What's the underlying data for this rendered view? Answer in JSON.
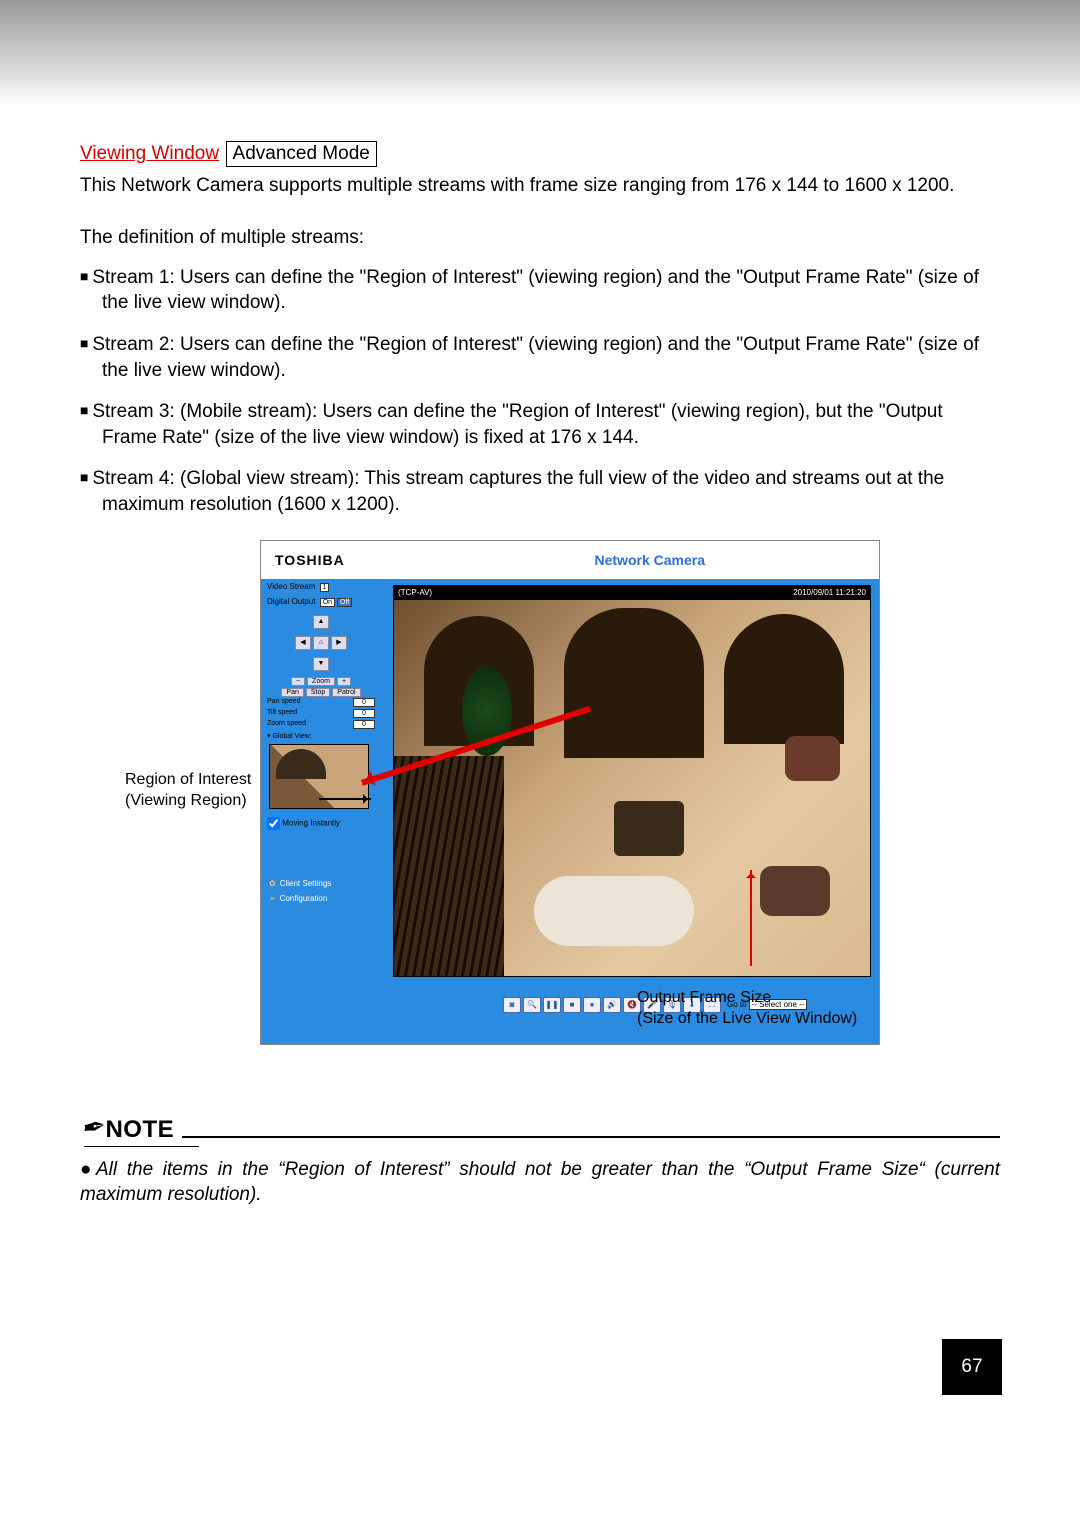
{
  "title": {
    "link": "Viewing Window",
    "badge": "Advanced Mode"
  },
  "intro": "This Network Camera supports multiple streams with frame size ranging from 176 x 144 to 1600 x 1200.",
  "defn_heading": "The definition of multiple streams:",
  "streams": [
    "Stream 1: Users can define the \"Region of Interest\" (viewing region) and the \"Output Frame Rate\" (size of the live view window).",
    "Stream 2: Users can define the \"Region of Interest\" (viewing region) and the \"Output Frame Rate\" (size of the live view window).",
    "Stream 3: (Mobile stream): Users can define the \"Region of Interest\" (viewing region), but the \"Output Frame Rate\" (size of the live view window) is fixed at 176 x 144.",
    "Stream 4: (Global view stream): This stream captures the full view of the video and streams out at the maximum resolution (1600 x 1200)."
  ],
  "camera_ui": {
    "brand": "TOSHIBA",
    "product": "Network Camera",
    "video_stream_label": "Video Stream",
    "video_stream_value": "1",
    "digital_output_label": "Digital Output",
    "digital_output_on": "On",
    "digital_output_off": "Off",
    "zoom_minus": "−",
    "zoom_label": "Zoom",
    "zoom_plus": "+",
    "pan_btn": "Pan",
    "stop_btn": "Stop",
    "patrol_btn": "Patrol",
    "pan_speed": "Pan speed",
    "tilt_speed": "Tilt speed",
    "zoom_speed": "Zoom speed",
    "speed_val": "0",
    "global_view": "Global View:",
    "moving_instantly": "Moving Instantly",
    "client_settings": "Client Settings",
    "configuration": "Configuration",
    "overlay_proto": "(TCP-AV)",
    "overlay_time": "2010/09/01 11:21:20",
    "goto_label": "Go to",
    "goto_value": "-- Select one --"
  },
  "callouts": {
    "roi_l1": "Region of Interest",
    "roi_l2": "(Viewing Region)",
    "ofs_l1": "Output Frame Size",
    "ofs_l2": "(Size of the Live View Window)"
  },
  "note": {
    "heading": "NOTE",
    "body": "All the items in the “Region of Interest” should not be greater than the “Output Frame Size“ (current maximum resolution)."
  },
  "page_number": "67"
}
